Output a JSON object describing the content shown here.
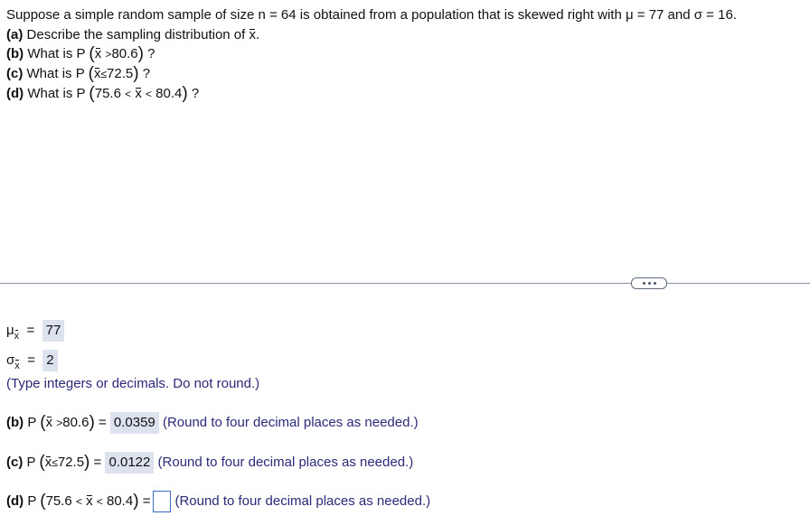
{
  "question": {
    "intro": "Suppose a simple random sample of size n = 64 is obtained from a population that is skewed right with μ = 77 and σ = 16.",
    "parts": [
      {
        "label": "(a)",
        "text": "Describe the sampling distribution of",
        "var": "x",
        "end": "."
      },
      {
        "label": "(b)",
        "text": "What is P",
        "var": "x",
        "rel": ">",
        "value": "80.6",
        "end": "?"
      },
      {
        "label": "(c)",
        "text": "What is P",
        "var": "x",
        "rel": "≤",
        "value": "72.5",
        "end": "?"
      },
      {
        "label": "(d)",
        "text": "What is P",
        "low": "75.6",
        "rel": "<",
        "var": "x",
        "rel2": "<",
        "high": "80.4",
        "end": "?"
      }
    ]
  },
  "more_button": {
    "icon": "ellipsis-icon"
  },
  "answers": {
    "mean": {
      "symbol": "μ",
      "sub": "x",
      "eq": "=",
      "value": "77"
    },
    "sd": {
      "symbol": "σ",
      "sub": "x",
      "eq": "=",
      "value": "2"
    },
    "type_hint": "(Type integers or decimals. Do not round.)",
    "b": {
      "label": "(b)",
      "p": "P",
      "var": "x",
      "rel": ">",
      "value": "80.6",
      "eq": "=",
      "answer": "0.0359",
      "hint": "(Round to four decimal places as needed.)"
    },
    "c": {
      "label": "(c)",
      "p": "P",
      "var": "x",
      "rel": "≤",
      "value": "72.5",
      "eq": "=",
      "answer": "0.0122",
      "hint": "(Round to four decimal places as needed.)"
    },
    "d": {
      "label": "(d)",
      "p": "P",
      "low": "75.6",
      "rel": "<",
      "var": "x",
      "rel2": "<",
      "high": "80.4",
      "eq": "=",
      "answer": "",
      "hint": "(Round to four decimal places as needed.)"
    }
  }
}
